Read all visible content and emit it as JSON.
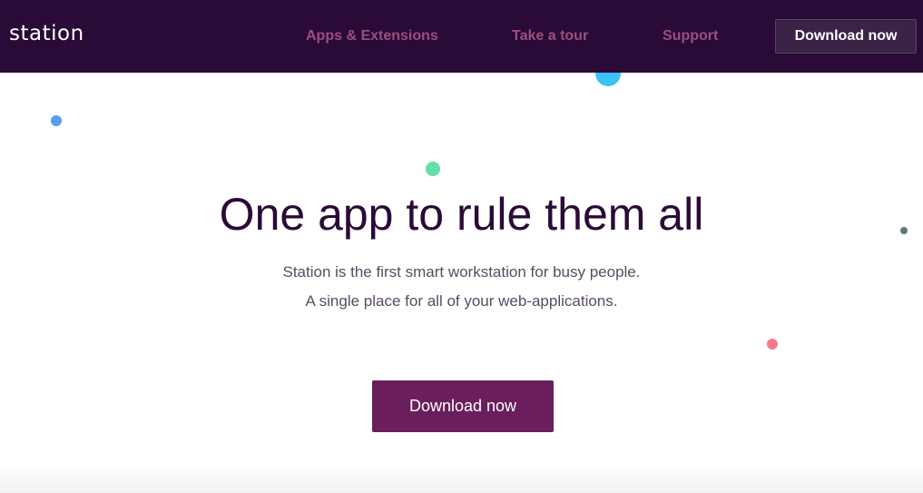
{
  "nav": {
    "logo": "station",
    "links": [
      {
        "label": "Apps & Extensions"
      },
      {
        "label": "Take a tour"
      },
      {
        "label": "Support"
      }
    ],
    "download_label": "Download now"
  },
  "hero": {
    "title": "One app to rule them all",
    "subtitle_line1": "Station is the first smart workstation for busy people.",
    "subtitle_line2": "A single place for all of your web-applications.",
    "download_label": "Download now"
  },
  "colors": {
    "nav_background": "#2a0a36",
    "nav_link": "#9b4f80",
    "cta_background": "#6a1f5c",
    "title_text": "#2a0a36",
    "dot_cyan": "#3cc2f5",
    "dot_blue": "#5a9cf0",
    "dot_green": "#64dfa5",
    "dot_slate": "#587b80",
    "dot_pink": "#f47b8b"
  }
}
